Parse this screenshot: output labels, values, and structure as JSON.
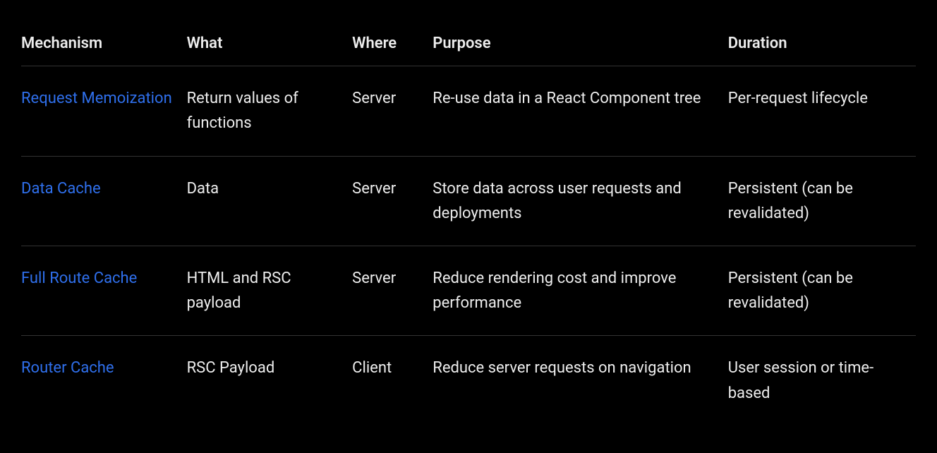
{
  "table": {
    "headers": {
      "mechanism": "Mechanism",
      "what": "What",
      "where": "Where",
      "purpose": "Purpose",
      "duration": "Duration"
    },
    "rows": [
      {
        "mechanism": "Request Memoization",
        "what": "Return values of functions",
        "where": "Server",
        "purpose": "Re-use data in a React Component tree",
        "duration": "Per-request lifecycle"
      },
      {
        "mechanism": "Data Cache",
        "what": "Data",
        "where": "Server",
        "purpose": "Store data across user requests and deployments",
        "duration": "Persistent (can be revalidated)"
      },
      {
        "mechanism": "Full Route Cache",
        "what": "HTML and RSC payload",
        "where": "Server",
        "purpose": "Reduce rendering cost and improve performance",
        "duration": "Persistent (can be revalidated)"
      },
      {
        "mechanism": "Router Cache",
        "what": "RSC Payload",
        "where": "Client",
        "purpose": "Reduce server requests on navigation",
        "duration": "User session or time-based"
      }
    ]
  }
}
